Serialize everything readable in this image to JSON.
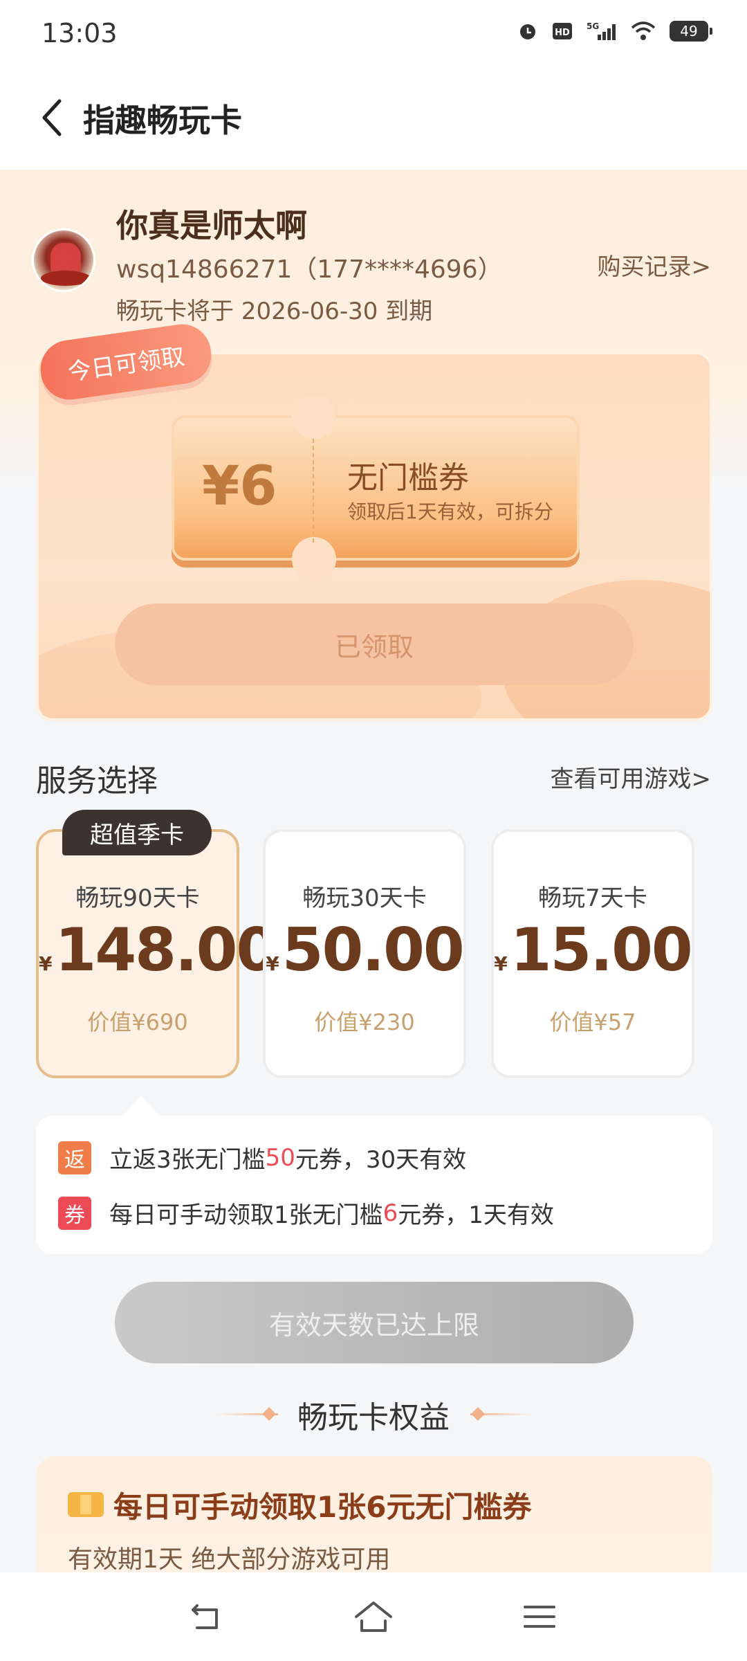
{
  "status": {
    "time": "13:03",
    "battery": "49",
    "signal": "5G",
    "hd": "HD"
  },
  "header": {
    "title": "指趣畅玩卡"
  },
  "user": {
    "name": "你真是师太啊",
    "account": "wsq14866271（177****4696）",
    "expire": "畅玩卡将于 2026-06-30 到期",
    "purchase_link": "购买记录>"
  },
  "daily_coupon": {
    "tag": "今日可领取",
    "amount": "¥6",
    "title": "无门槛券",
    "desc": "领取后1天有效，可拆分",
    "button": "已领取"
  },
  "service": {
    "title": "服务选择",
    "view_games": "查看可用游戏>",
    "badge": "超值季卡",
    "plans": [
      {
        "name": "畅玩90天卡",
        "currency": "¥",
        "price": "148.00",
        "worth": "价值¥690",
        "selected": true
      },
      {
        "name": "畅玩30天卡",
        "currency": "¥",
        "price": "50.00",
        "worth": "价值¥230",
        "selected": false
      },
      {
        "name": "畅玩7天卡",
        "currency": "¥",
        "price": "15.00",
        "worth": "价值¥57",
        "selected": false
      }
    ]
  },
  "benefits": [
    {
      "tag": "返",
      "pre": "立返3张无门槛",
      "hl": "50",
      "post": "元券，30天有效",
      "color": "#f07c4a"
    },
    {
      "tag": "券",
      "pre": "每日可手动领取1张无门槛",
      "hl": "6",
      "post": "元券，1天有效",
      "color": "#ec4b55"
    }
  ],
  "limit_button": "有效天数已达上限",
  "rights": {
    "title": "畅玩卡权益",
    "headline": "每日可手动领取1张6元无门槛券",
    "sub": "有效期1天  绝大部分游戏可用"
  }
}
